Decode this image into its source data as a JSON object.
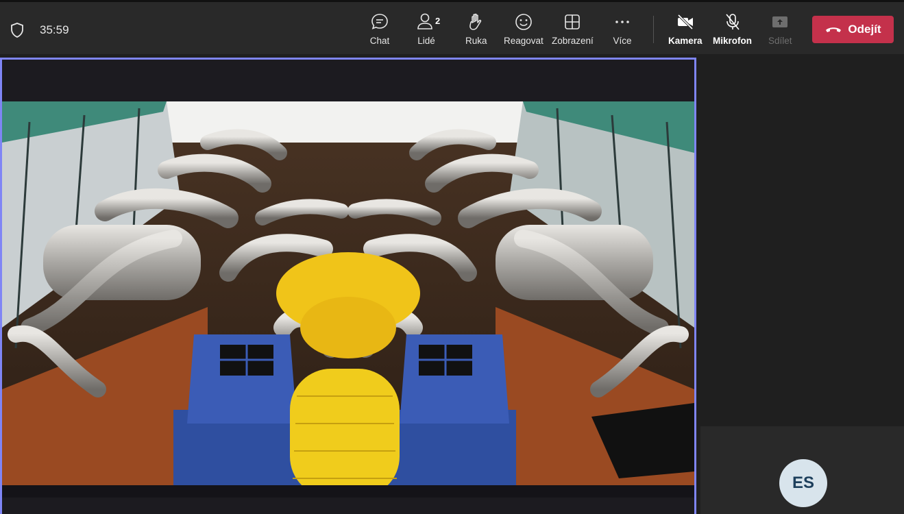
{
  "header": {
    "timer": "35:59",
    "tools": {
      "chat": "Chat",
      "people": "Lidé",
      "people_count": "2",
      "raise_hand": "Ruka",
      "react": "Reagovat",
      "view": "Zobrazení",
      "more": "Více",
      "camera": "Kamera",
      "microphone": "Mikrofon",
      "share": "Sdílet"
    },
    "leave_label": "Odejít"
  },
  "colors": {
    "accent_border": "#7f85f5",
    "leave_button": "#c4314b",
    "avatar_bg": "#d8e4ec"
  },
  "participant": {
    "initials": "ES"
  }
}
